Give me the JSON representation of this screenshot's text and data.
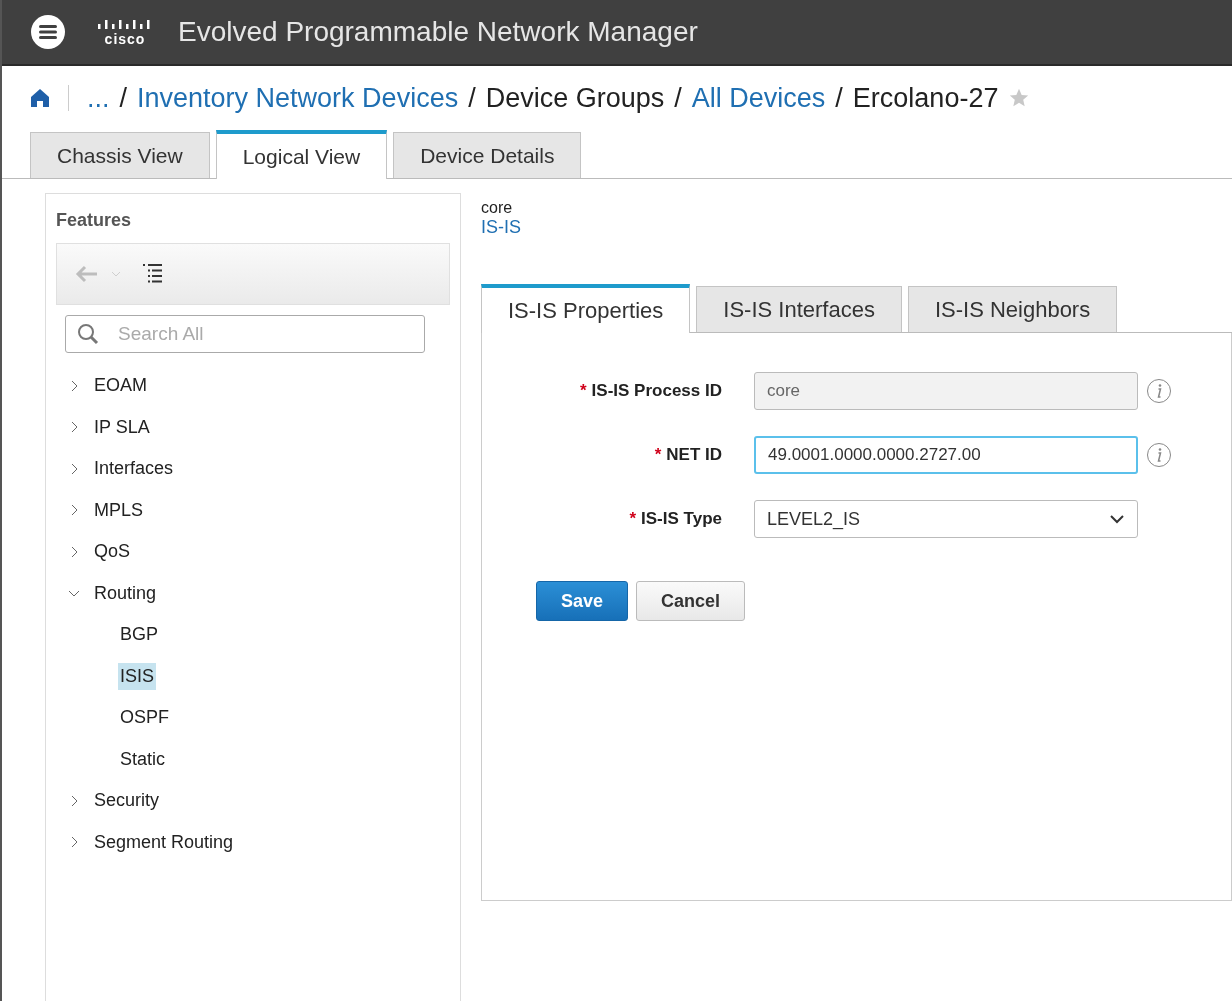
{
  "header": {
    "title": "Evolved Programmable Network Manager",
    "logo_text": "cisco"
  },
  "breadcrumb": [
    {
      "kind": "link",
      "label": "..."
    },
    {
      "kind": "separator",
      "label": "/"
    },
    {
      "kind": "link",
      "label": "Inventory Network Devices"
    },
    {
      "kind": "separator",
      "label": "/"
    },
    {
      "kind": "text",
      "label": "Device Groups"
    },
    {
      "kind": "separator",
      "label": "/"
    },
    {
      "kind": "link",
      "label": "All Devices"
    },
    {
      "kind": "separator",
      "label": "/"
    },
    {
      "kind": "text",
      "label": "Ercolano-27"
    }
  ],
  "favorite": false,
  "tabs": [
    {
      "label": "Chassis View",
      "selected": false
    },
    {
      "label": "Logical View",
      "selected": true
    },
    {
      "label": "Device Details",
      "selected": false
    }
  ],
  "sidebar": {
    "title": "Features",
    "search": {
      "placeholder": "Search All"
    },
    "items": [
      {
        "label": "EOAM",
        "expanded": false
      },
      {
        "label": "IP SLA",
        "expanded": false
      },
      {
        "label": "Interfaces",
        "expanded": false
      },
      {
        "label": "MPLS",
        "expanded": false
      },
      {
        "label": "QoS",
        "expanded": false
      },
      {
        "label": "Routing",
        "expanded": true,
        "children": [
          {
            "label": "BGP",
            "selected": false
          },
          {
            "label": "ISIS",
            "selected": true
          },
          {
            "label": "OSPF",
            "selected": false
          },
          {
            "label": "Static",
            "selected": false
          }
        ]
      },
      {
        "label": "Security",
        "expanded": false
      },
      {
        "label": "Segment Routing",
        "expanded": false
      }
    ]
  },
  "content": {
    "context": "core",
    "feature": "IS-IS",
    "tabs": [
      {
        "label": "IS-IS Properties",
        "selected": true
      },
      {
        "label": "IS-IS Interfaces",
        "selected": false
      },
      {
        "label": "IS-IS Neighbors",
        "selected": false
      }
    ],
    "fields": [
      {
        "kind": "text",
        "required_mark": "*",
        "label": "IS-IS Process ID",
        "value": "core",
        "disabled": true,
        "focused": false,
        "info": true
      },
      {
        "kind": "text",
        "required_mark": "*",
        "label": "NET ID",
        "value": "49.0001.0000.0000.2727.00",
        "disabled": false,
        "focused": true,
        "info": true
      },
      {
        "kind": "select",
        "required_mark": "*",
        "label": "IS-IS Type",
        "value": "LEVEL2_IS",
        "info": false
      }
    ],
    "buttons": [
      {
        "label": "Save",
        "kind": "primary"
      },
      {
        "label": "Cancel",
        "kind": "secondary"
      }
    ]
  }
}
